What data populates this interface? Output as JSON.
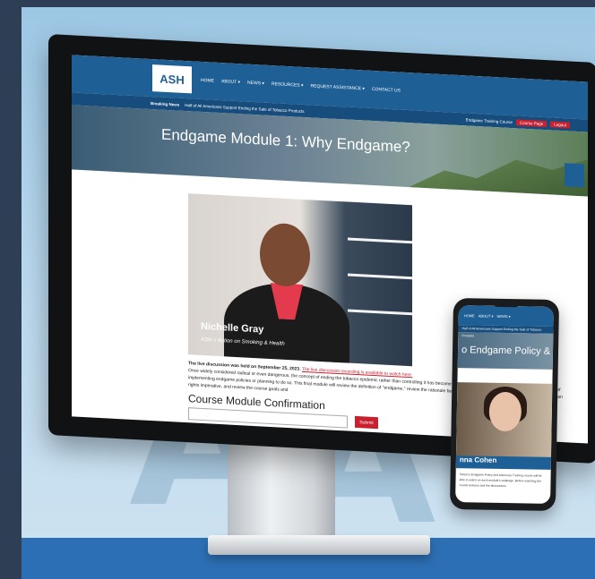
{
  "site": {
    "logo": "ASH",
    "nav": [
      "HOME",
      "ABOUT ▾",
      "NEWS ▾",
      "RESOURCES ▾",
      "REQUEST ASSISTANCE ▾",
      "CONTACT US"
    ],
    "breaking_label": "Breaking News",
    "breaking_text": "Half of All Americans Support Ending the Sale of Tobacco Products",
    "course_label": "Endgame Training Course",
    "course_page_btn": "Course Page",
    "logout_btn": "Logout"
  },
  "hero": {
    "title": "Endgame Module 1: Why Endgame?"
  },
  "video": {
    "speaker_name": "Nichelle Gray",
    "speaker_org": "ASH > Action on Smoking & Health"
  },
  "content": {
    "live_text": "The live discussion was held on September 25, 2023.",
    "live_link": "The live discussion recording is available to watch here.",
    "paragraph": "Once widely considered radical or even dangerous, the concept of ending the tobacco epidemic rather than controlling it has become mainstream. Multiple jurisdictions are in the process of implementing endgame policies or planning to do so. This final module will review the definition of \"endgame,\" review the rationale behind it, touching specifically on addiction and the human rights imperative, and review the course goals and",
    "confirm_title": "Course Module Confirmation",
    "submit_label": "Submit"
  },
  "phone": {
    "hero_title": "o Endgame Policy & Advo",
    "speaker_name": "nna Cohen",
    "text": "Tobacco Endgame Policy and Advocacy Training course will be able to watch on each module's webpage. Before watching the course lectures and the discussions"
  },
  "watermark": "A"
}
